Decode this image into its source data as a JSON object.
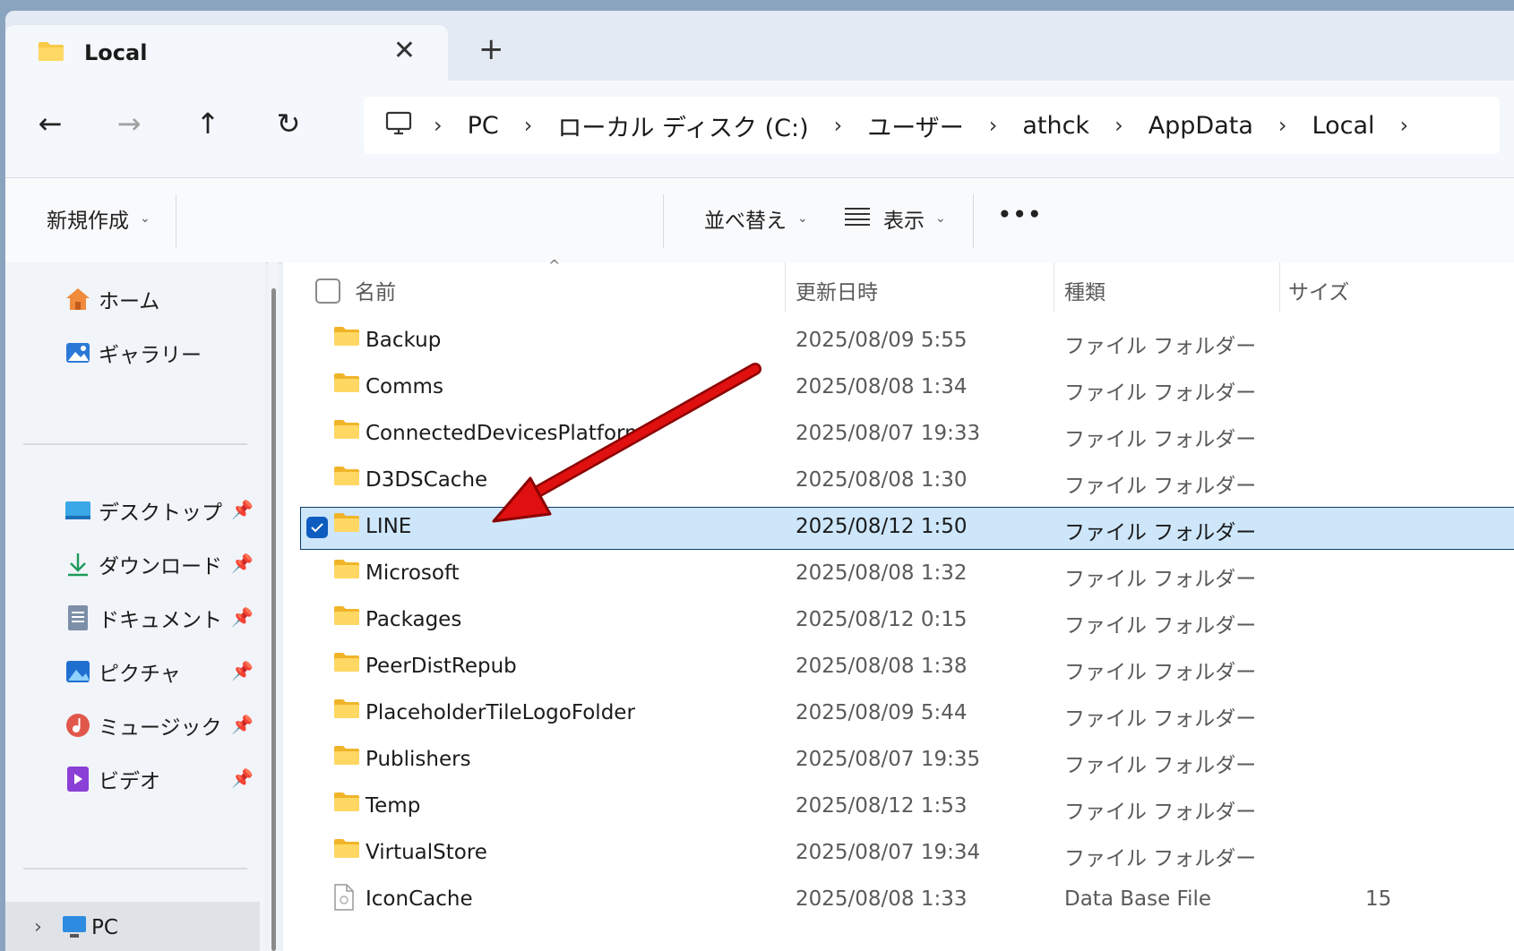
{
  "tab": {
    "title": "Local",
    "close_glyph": "✕",
    "new_tab_glyph": "+"
  },
  "nav": {
    "back_glyph": "←",
    "forward_glyph": "→",
    "up_glyph": "↑",
    "refresh_glyph": "↻",
    "breadcrumbs": [
      "PC",
      "ローカル ディスク (C:)",
      "ユーザー",
      "athck",
      "AppData",
      "Local"
    ],
    "separator": "›"
  },
  "toolbar": {
    "new_label": "新規作成",
    "sort_label": "並べ替え",
    "view_label": "表示",
    "more_glyph": "•••",
    "caret": "⌄"
  },
  "sidebar": {
    "home": "ホーム",
    "gallery": "ギャラリー",
    "desktop": "デスクトップ",
    "downloads": "ダウンロード",
    "documents": "ドキュメント",
    "pictures": "ピクチャ",
    "music": "ミュージック",
    "videos": "ビデオ",
    "pc": "PC",
    "pin_glyph": "📌",
    "chevron": "›"
  },
  "columns": {
    "name": "名前",
    "date": "更新日時",
    "type": "種類",
    "size": "サイズ",
    "sort_glyph": "^"
  },
  "files": [
    {
      "name": "Backup",
      "date": "2025/08/09 5:55",
      "type": "ファイル フォルダー",
      "size": "",
      "kind": "folder"
    },
    {
      "name": "Comms",
      "date": "2025/08/08 1:34",
      "type": "ファイル フォルダー",
      "size": "",
      "kind": "folder"
    },
    {
      "name": "ConnectedDevicesPlatform",
      "date": "2025/08/07 19:33",
      "type": "ファイル フォルダー",
      "size": "",
      "kind": "folder"
    },
    {
      "name": "D3DSCache",
      "date": "2025/08/08 1:30",
      "type": "ファイル フォルダー",
      "size": "",
      "kind": "folder"
    },
    {
      "name": "LINE",
      "date": "2025/08/12 1:50",
      "type": "ファイル フォルダー",
      "size": "",
      "kind": "folder",
      "selected": true
    },
    {
      "name": "Microsoft",
      "date": "2025/08/08 1:32",
      "type": "ファイル フォルダー",
      "size": "",
      "kind": "folder"
    },
    {
      "name": "Packages",
      "date": "2025/08/12 0:15",
      "type": "ファイル フォルダー",
      "size": "",
      "kind": "folder"
    },
    {
      "name": "PeerDistRepub",
      "date": "2025/08/08 1:38",
      "type": "ファイル フォルダー",
      "size": "",
      "kind": "folder"
    },
    {
      "name": "PlaceholderTileLogoFolder",
      "date": "2025/08/09 5:44",
      "type": "ファイル フォルダー",
      "size": "",
      "kind": "folder"
    },
    {
      "name": "Publishers",
      "date": "2025/08/07 19:35",
      "type": "ファイル フォルダー",
      "size": "",
      "kind": "folder"
    },
    {
      "name": "Temp",
      "date": "2025/08/12 1:53",
      "type": "ファイル フォルダー",
      "size": "",
      "kind": "folder"
    },
    {
      "name": "VirtualStore",
      "date": "2025/08/07 19:34",
      "type": "ファイル フォルダー",
      "size": "",
      "kind": "folder"
    },
    {
      "name": "IconCache",
      "date": "2025/08/08 1:33",
      "type": "Data Base File",
      "size": "15",
      "kind": "file"
    }
  ],
  "colors": {
    "accent": "#0f5cc0",
    "selection": "#cde6fa",
    "annotation_arrow": "#e01010",
    "folder": "#f7c948"
  }
}
